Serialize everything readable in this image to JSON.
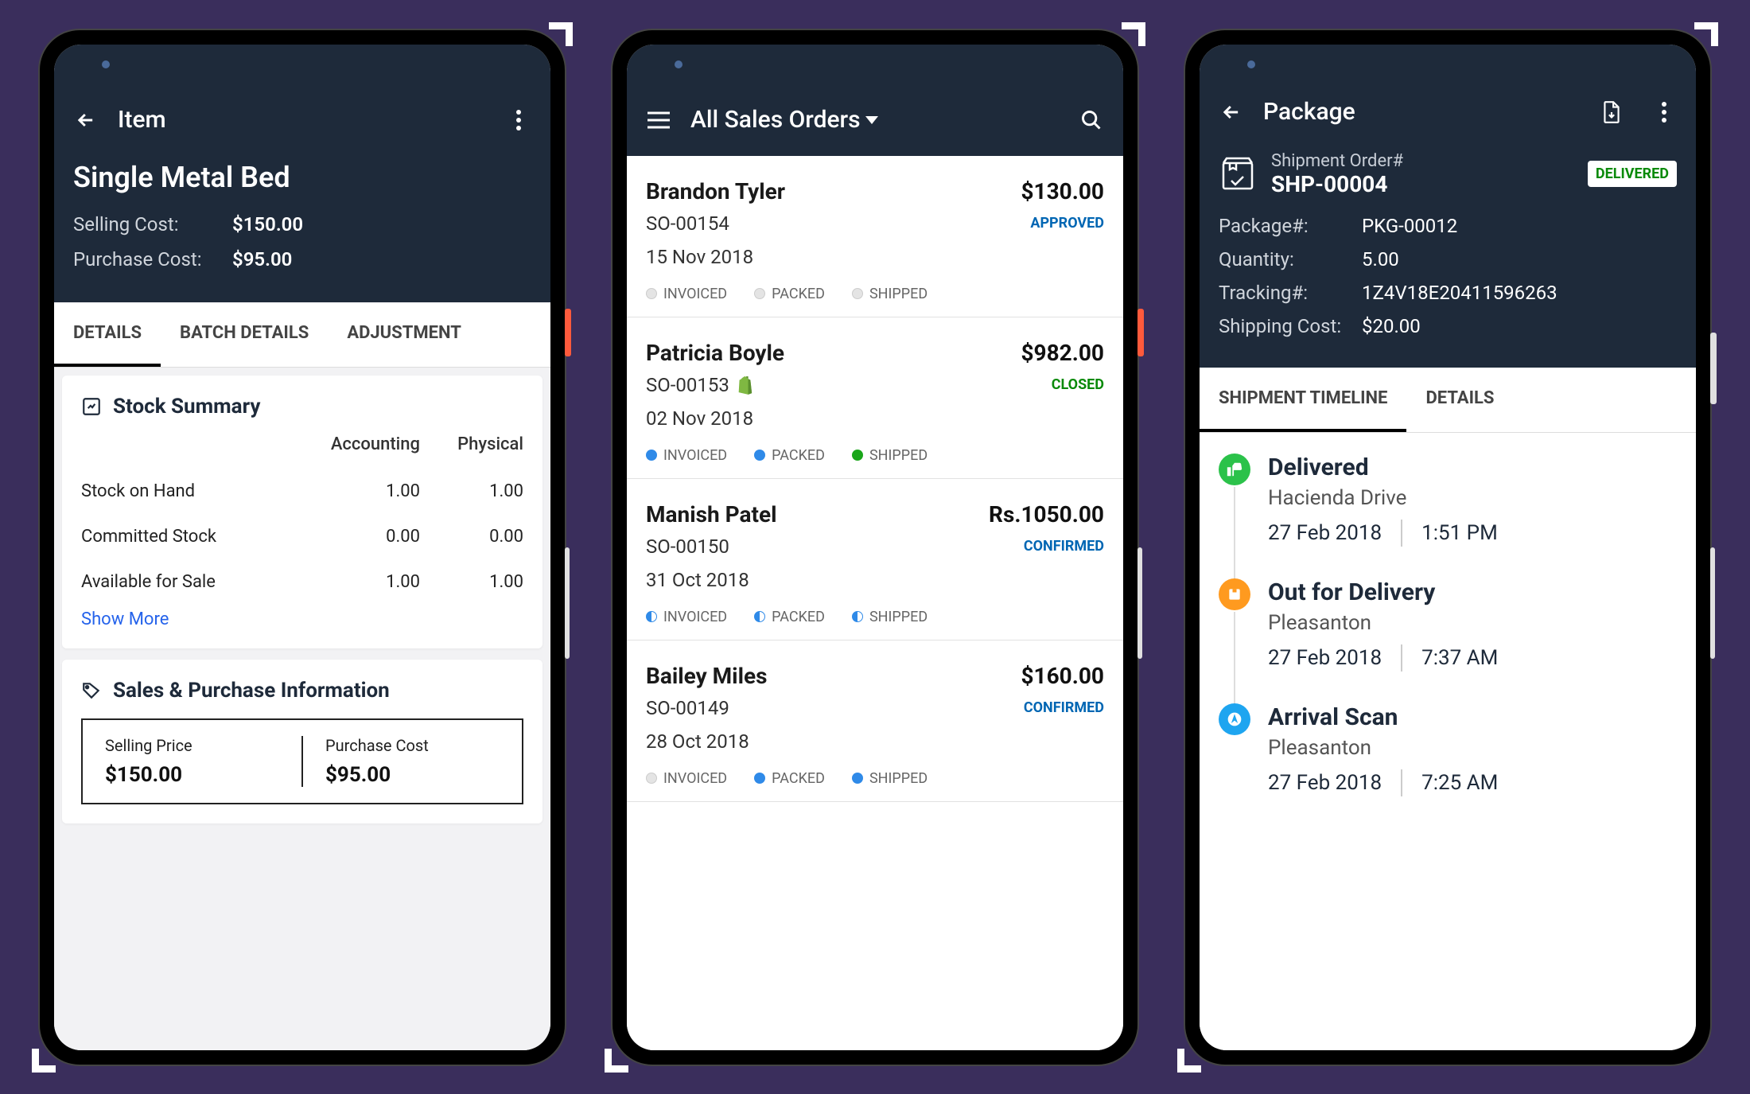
{
  "phone1": {
    "toolbar_title": "Item",
    "item_name": "Single Metal Bed",
    "selling_label": "Selling Cost:",
    "selling_value": "$150.00",
    "purchase_label": "Purchase Cost:",
    "purchase_value": "$95.00",
    "tabs": [
      "DETAILS",
      "BATCH DETAILS",
      "ADJUSTMENT"
    ],
    "stock_title": "Stock Summary",
    "col_accounting": "Accounting",
    "col_physical": "Physical",
    "rows": [
      {
        "label": "Stock on Hand",
        "acc": "1.00",
        "phy": "1.00"
      },
      {
        "label": "Committed Stock",
        "acc": "0.00",
        "phy": "0.00"
      },
      {
        "label": "Available for Sale",
        "acc": "1.00",
        "phy": "1.00"
      }
    ],
    "show_more": "Show More",
    "sp_title": "Sales & Purchase Information",
    "sp_selling_label": "Selling Price",
    "sp_selling_value": "$150.00",
    "sp_purchase_label": "Purchase Cost",
    "sp_purchase_value": "$95.00"
  },
  "phone2": {
    "toolbar_title": "All Sales Orders",
    "pill_invoiced": "INVOICED",
    "pill_packed": "PACKED",
    "pill_shipped": "SHIPPED",
    "orders": [
      {
        "name": "Brandon Tyler",
        "id": "SO-00154",
        "date": "15 Nov 2018",
        "amount": "$130.00",
        "status": "APPROVED",
        "status_class": "approved",
        "shopify": false,
        "dots": [
          "grey",
          "grey",
          "grey"
        ]
      },
      {
        "name": "Patricia Boyle",
        "id": "SO-00153",
        "date": "02 Nov 2018",
        "amount": "$982.00",
        "status": "CLOSED",
        "status_class": "closed",
        "shopify": true,
        "dots": [
          "blue",
          "blue",
          "green"
        ]
      },
      {
        "name": "Manish Patel",
        "id": "SO-00150",
        "date": "31 Oct 2018",
        "amount": "Rs.1050.00",
        "status": "CONFIRMED",
        "status_class": "confirmed",
        "shopify": false,
        "dots": [
          "halfblue",
          "halfblue",
          "halfblue"
        ]
      },
      {
        "name": "Bailey Miles",
        "id": "SO-00149",
        "date": "28 Oct 2018",
        "amount": "$160.00",
        "status": "CONFIRMED",
        "status_class": "confirmed",
        "shopify": false,
        "dots": [
          "grey",
          "blue",
          "blue"
        ]
      }
    ]
  },
  "phone3": {
    "toolbar_title": "Package",
    "shipment_label": "Shipment Order#",
    "shipment_value": "SHP-00004",
    "badge": "DELIVERED",
    "fields": [
      {
        "l": "Package#:",
        "v": "PKG-00012"
      },
      {
        "l": "Quantity:",
        "v": "5.00"
      },
      {
        "l": "Tracking#:",
        "v": "1Z4V18E20411596263"
      },
      {
        "l": "Shipping Cost:",
        "v": "$20.00"
      }
    ],
    "tabs": [
      "SHIPMENT TIMELINE",
      "DETAILS"
    ],
    "timeline": [
      {
        "title": "Delivered",
        "loc": "Hacienda Drive",
        "date": "27 Feb 2018",
        "time": "1:51 PM",
        "color": "green"
      },
      {
        "title": "Out for Delivery",
        "loc": "Pleasanton",
        "date": "27 Feb 2018",
        "time": "7:37 AM",
        "color": "orange"
      },
      {
        "title": "Arrival Scan",
        "loc": "Pleasanton",
        "date": "27 Feb 2018",
        "time": "7:25 AM",
        "color": "blue"
      }
    ]
  }
}
